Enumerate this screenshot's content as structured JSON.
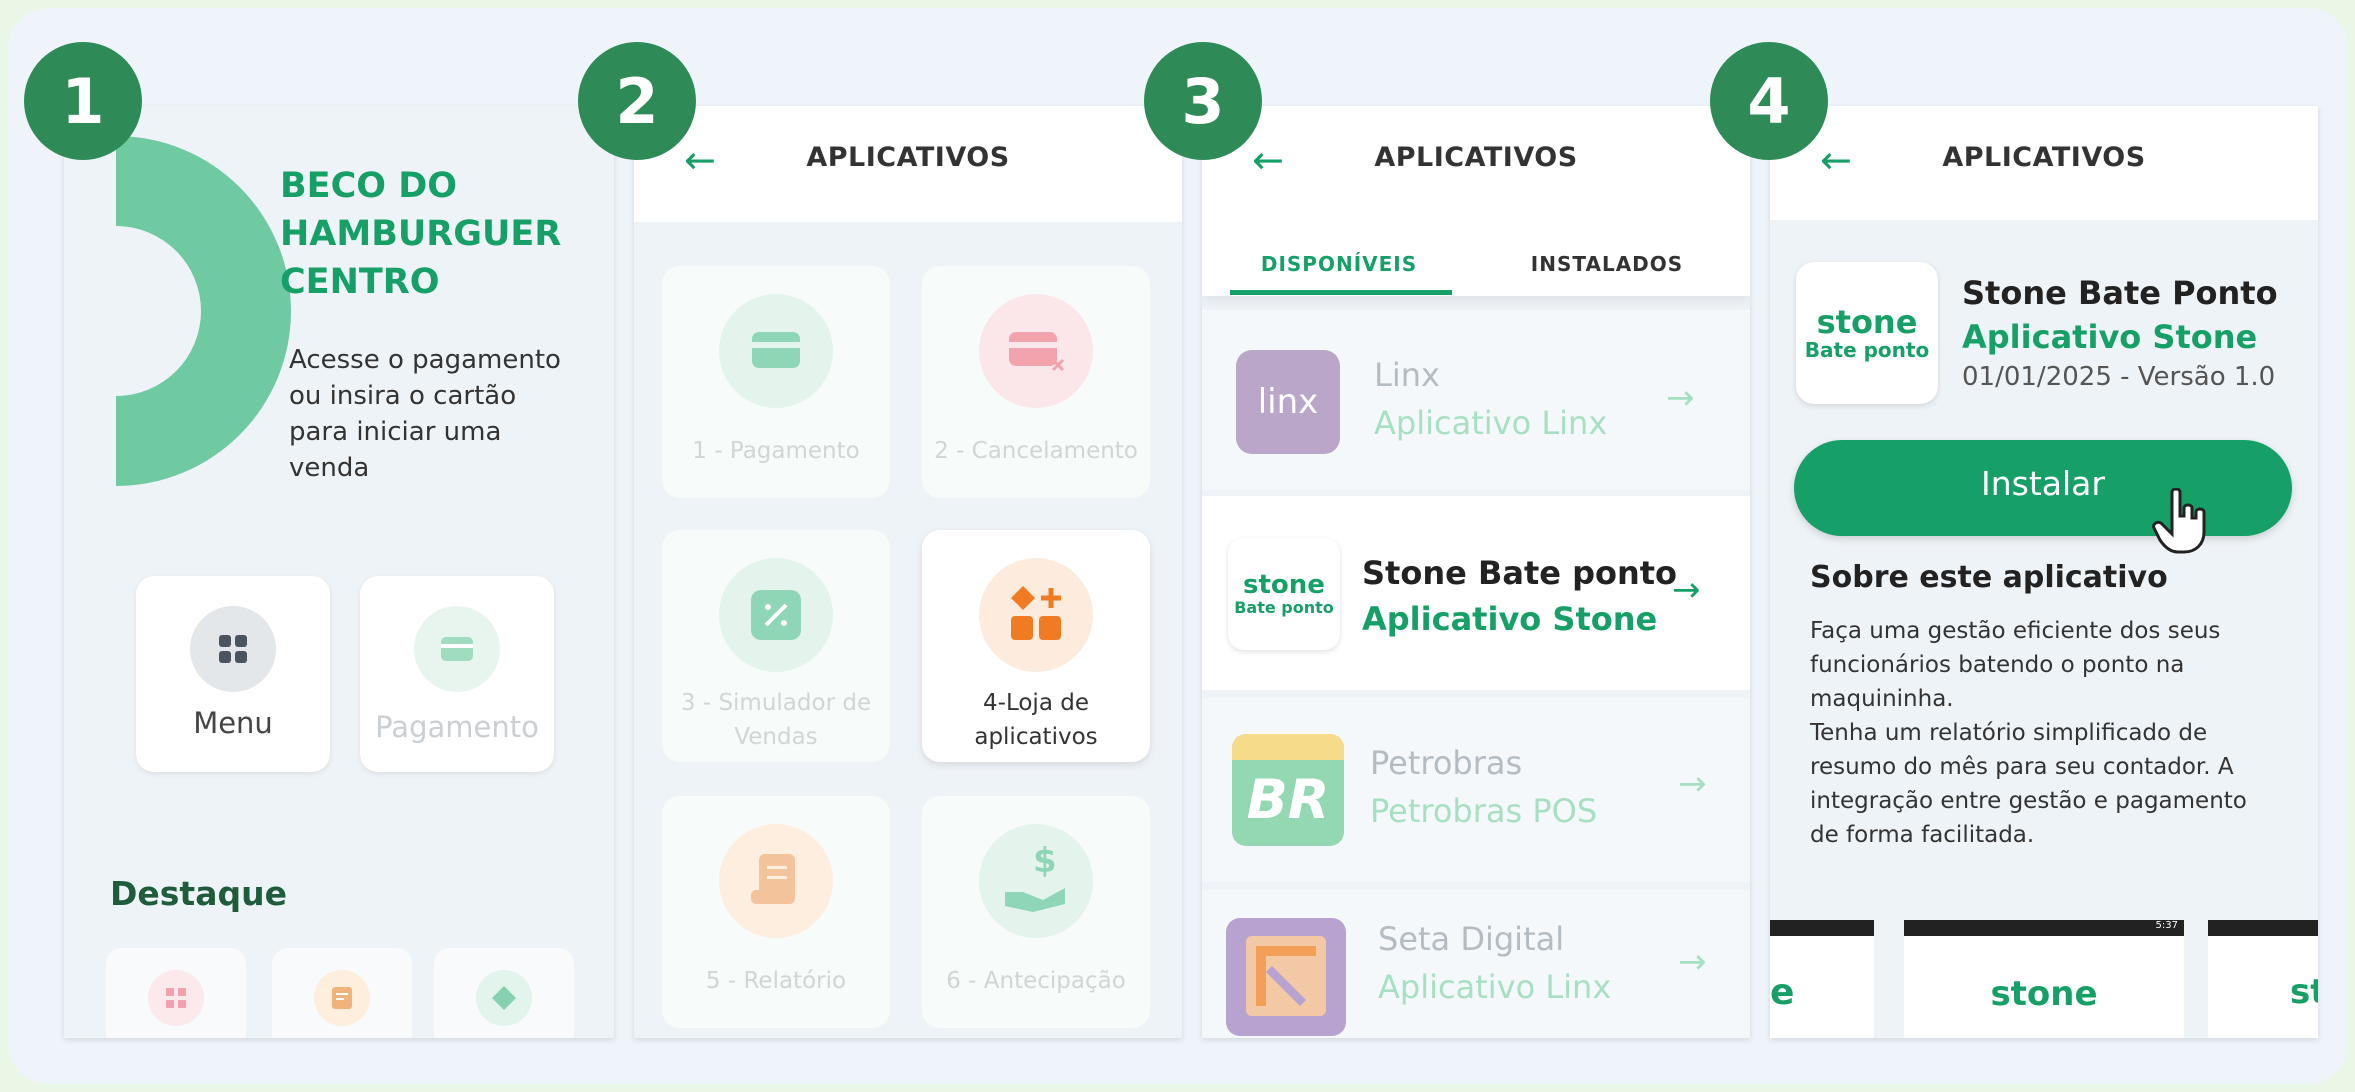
{
  "steps": [
    "1",
    "2",
    "3",
    "4"
  ],
  "s1": {
    "title_lines": [
      "BECO DO",
      "HAMBURGUER",
      "CENTRO"
    ],
    "desc_lines": [
      "Acesse o pagamento",
      "ou insira o cartão",
      "para iniciar uma",
      "venda"
    ],
    "menu_label": "Menu",
    "pay_label": "Pagamento",
    "section": "Destaque"
  },
  "s2": {
    "title": "APLICATIVOS",
    "tiles": [
      "1 - Pagamento",
      "2 - Cancelamento",
      "3 - Simulador de",
      "Vendas",
      "4-Loja de",
      "aplicativos",
      "5 - Relatório",
      "6 - Antecipação"
    ]
  },
  "s3": {
    "title": "APLICATIVOS",
    "tab1": "DISPONÍVEIS",
    "tab2": "INSTALADOS",
    "apps": [
      {
        "name": "Linx",
        "sub": "Aplicativo Linx",
        "logo": "linx"
      },
      {
        "name": "Stone Bate ponto",
        "sub": "Aplicativo Stone",
        "logo1": "stone",
        "logo2": "Bate ponto"
      },
      {
        "name": "Petrobras",
        "sub": "Petrobras POS",
        "logo": "BR"
      },
      {
        "name": "Seta Digital",
        "sub": "Aplicativo Linx"
      }
    ]
  },
  "s4": {
    "title": "APLICATIVOS",
    "app_name": "Stone Bate Ponto",
    "app_sub": "Aplicativo Stone",
    "meta": "01/01/2025 - Versão 1.0",
    "logo1": "stone",
    "logo2": "Bate ponto",
    "install": "Instalar",
    "about_title": "Sobre este aplicativo",
    "about_lines": [
      "Faça uma gestão eficiente dos seus",
      "funcionários batendo o ponto na",
      "maquininha.",
      "Tenha um relatório simplificado de",
      "resumo do mês para seu contador. A",
      "integração entre gestão e pagamento",
      "de forma facilitada."
    ],
    "shot_left": "e",
    "shot_mid": "stone",
    "shot_right": "st",
    "status": "5:37"
  },
  "colors": {
    "green": "#16a067",
    "dark_green": "#2e8b57",
    "pale": "#cfe9dc"
  }
}
